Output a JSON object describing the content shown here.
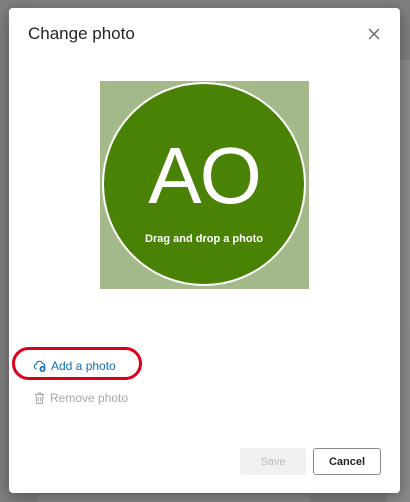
{
  "dialog": {
    "title": "Change photo",
    "avatar": {
      "initials": "AO",
      "drag_drop_text": "Drag and drop a photo",
      "circle_color": "#498205",
      "backdrop_color": "#a3b98a"
    },
    "add_photo_label": "Add a photo",
    "remove_photo_label": "Remove photo",
    "save_label": "Save",
    "cancel_label": "Cancel",
    "accent_color": "#0f6cbd",
    "highlight_color": "#d9001b"
  },
  "icons": {
    "close": "close-icon",
    "add_photo": "cloud-add-icon",
    "remove_photo": "trash-icon"
  }
}
